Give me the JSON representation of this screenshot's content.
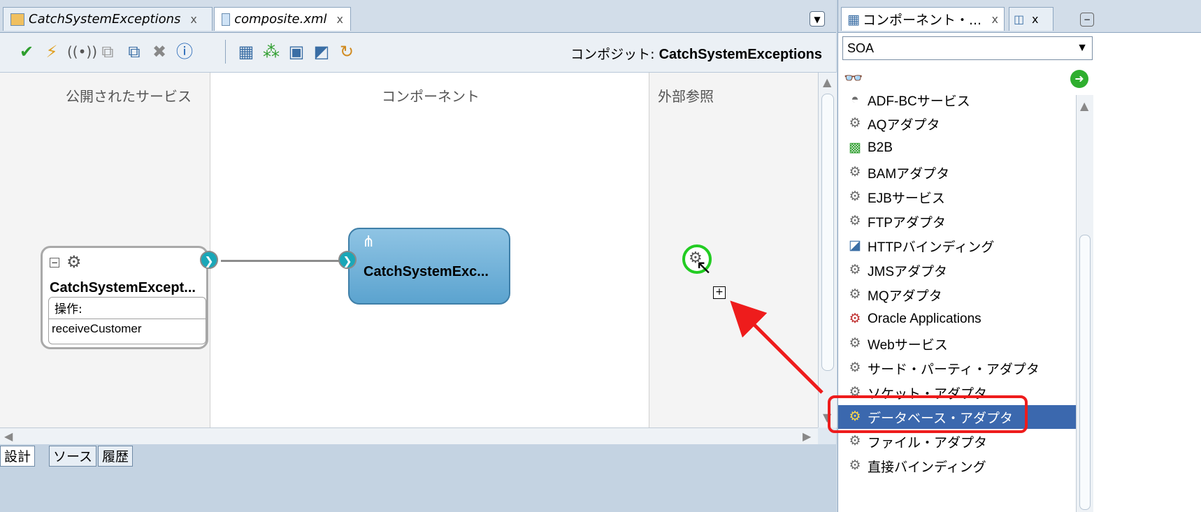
{
  "editor": {
    "tabs": [
      {
        "label": "CatchSystemExceptions",
        "close": "x"
      },
      {
        "label": "composite.xml",
        "close": "x"
      }
    ],
    "composite_label": "コンポジット:",
    "composite_name": "CatchSystemExceptions",
    "toolbar_icons": [
      "check-icon",
      "lightning-icon",
      "signal-icon",
      "copy-icon",
      "paste-icon",
      "delete-icon",
      "info-icon",
      "database-icon",
      "network-icon",
      "save-icon",
      "export-icon",
      "refresh-icon"
    ]
  },
  "canvas": {
    "col_services": "公開されたサービス",
    "col_components": "コンポーネント",
    "col_references": "外部参照",
    "service": {
      "name": "CatchSystemExcept...",
      "ops_label": "操作:",
      "operation": "receiveCustomer"
    },
    "component": {
      "name": "CatchSystemExc..."
    }
  },
  "bottom_tabs": [
    "設計",
    "ソース",
    "履歴"
  ],
  "palette": {
    "tab_label": "コンポーネント・...",
    "tab_close": "x",
    "category": "SOA",
    "search_placeholder": "",
    "items": [
      {
        "label": "ADF-BCサービス",
        "icon": "cylinder-icon"
      },
      {
        "label": "AQアダプタ",
        "icon": "gear-icon"
      },
      {
        "label": "B2B",
        "icon": "b2b-icon"
      },
      {
        "label": "BAMアダプタ",
        "icon": "gear-icon"
      },
      {
        "label": "EJBサービス",
        "icon": "gear-icon"
      },
      {
        "label": "FTPアダプタ",
        "icon": "gear-icon"
      },
      {
        "label": "HTTPバインディング",
        "icon": "http-icon"
      },
      {
        "label": "JMSアダプタ",
        "icon": "gear-icon"
      },
      {
        "label": "MQアダプタ",
        "icon": "gear-icon"
      },
      {
        "label": "Oracle Applications",
        "icon": "gear-icon"
      },
      {
        "label": "Webサービス",
        "icon": "gear-icon"
      },
      {
        "label": "サード・パーティ・アダプタ",
        "icon": "gear-icon"
      },
      {
        "label": "ソケット・アダプタ",
        "icon": "gear-icon"
      },
      {
        "label": "データベース・アダプタ",
        "icon": "database-adapter-icon"
      },
      {
        "label": "ファイル・アダプタ",
        "icon": "gear-icon"
      },
      {
        "label": "直接バインディング",
        "icon": "gear-icon"
      }
    ],
    "selected_index": 13
  },
  "colors": {
    "selection": "#3b68ae",
    "highlight": "#ee1c1c",
    "drop_ring": "#22cc22",
    "component": "#6fb2da"
  }
}
